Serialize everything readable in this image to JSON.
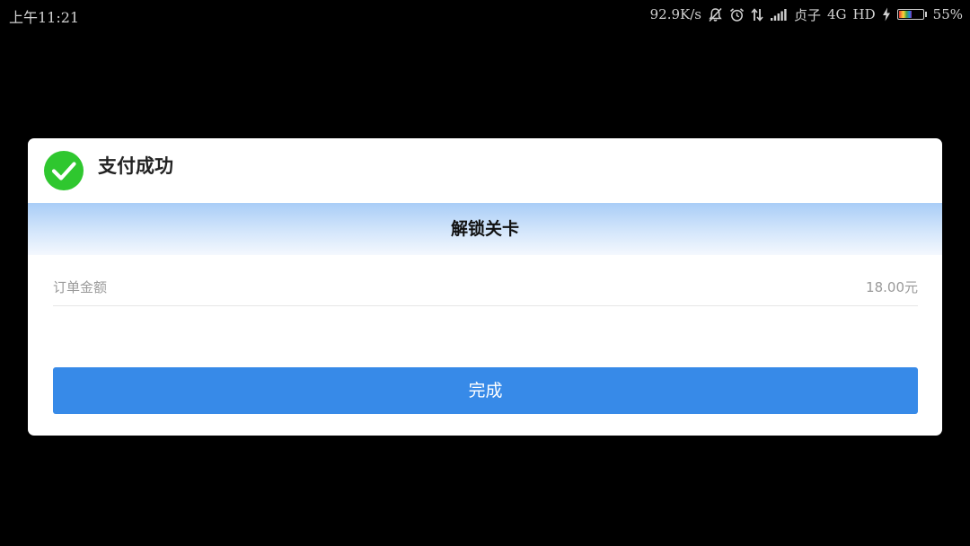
{
  "status_bar": {
    "time": "上午11:21",
    "network_speed": "92.9K/s",
    "carrier": "贞子",
    "network_type": "4G",
    "hd": "HD",
    "battery_percent": "55%",
    "battery_level": 0.55,
    "icons": [
      "muted-bell-icon",
      "alarm-icon",
      "data-transfer-icon",
      "signal-icon",
      "charging-icon",
      "battery-icon"
    ]
  },
  "dialog": {
    "title": "支付成功",
    "success_icon": "check-circle-icon",
    "success_color": "#2fc72f",
    "section_title": "解锁关卡",
    "order": {
      "label": "订单金额",
      "amount": "18.00元"
    },
    "done_label": "完成",
    "button_color": "#378ae8"
  }
}
